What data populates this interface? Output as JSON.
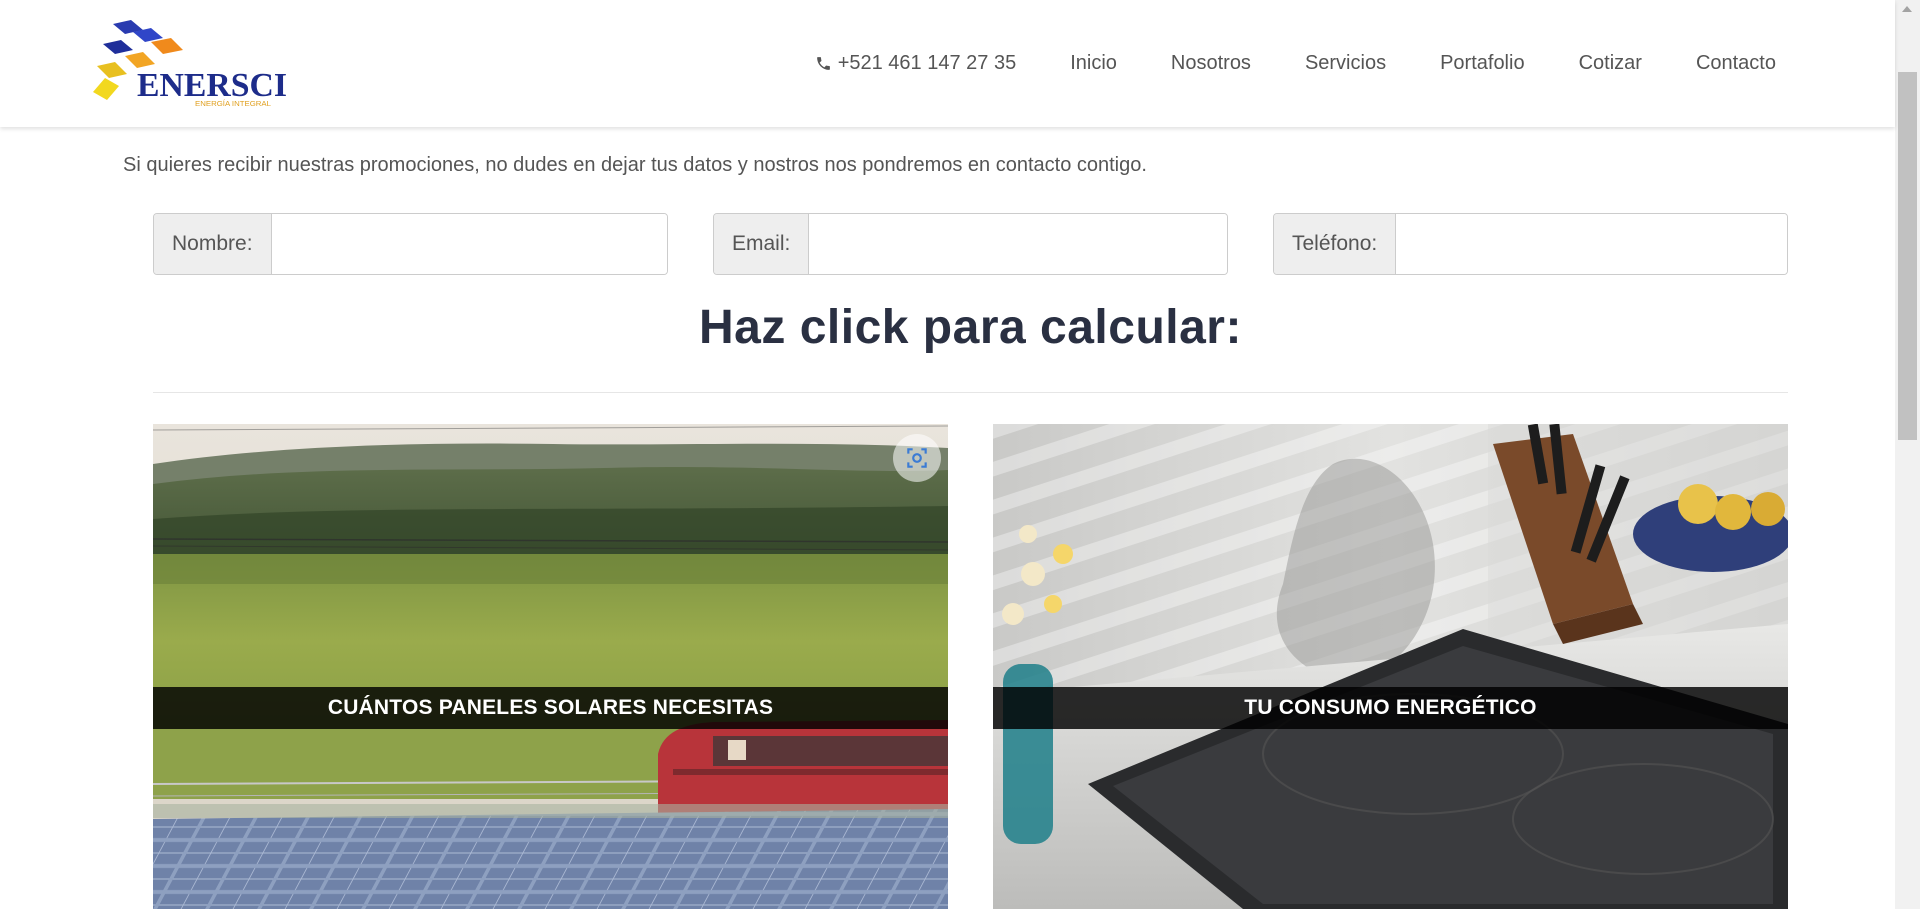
{
  "header": {
    "logo_text": "ENERSCI",
    "logo_tagline": "ENERGÍA INTEGRAL",
    "phone": "+521 461 147 27 35",
    "nav": [
      "Inicio",
      "Nosotros",
      "Servicios",
      "Portafolio",
      "Cotizar",
      "Contacto"
    ]
  },
  "intro": "Si quieres recibir nuestras promociones, no dudes en dejar tus datos y nostros nos pondremos en contacto contigo.",
  "form": {
    "nombre_label": "Nombre:",
    "email_label": "Email:",
    "telefono_label": "Teléfono:"
  },
  "heading": "Haz click para calcular:",
  "cards": [
    {
      "caption": "CUÁNTOS PANELES SOLARES NECESITAS",
      "icon": "lens-icon"
    },
    {
      "caption": "TU CONSUMO ENERGÉTICO"
    }
  ],
  "colors": {
    "heading": "#2a3042",
    "logo_blue": "#1d2c8a",
    "logo_orange": "#f08a1c",
    "logo_yellow": "#f2d81f"
  }
}
